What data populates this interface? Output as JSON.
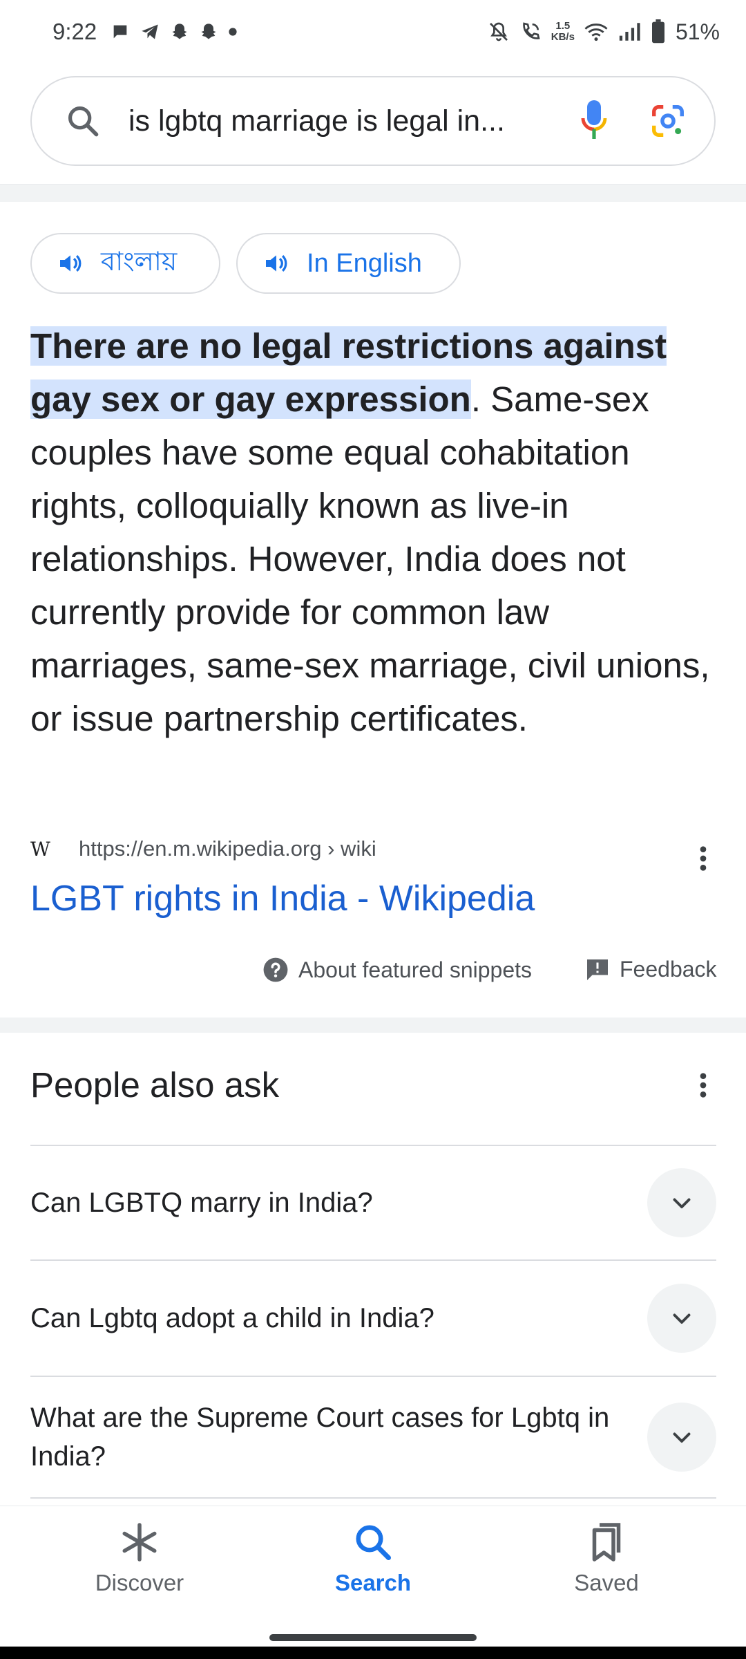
{
  "status_bar": {
    "time": "9:22",
    "net_speed_value": "1.5",
    "net_speed_unit": "KB/s",
    "battery": "51%",
    "icons": [
      "chat-icon",
      "telegram-icon",
      "snapchat-icon",
      "snapchat-icon",
      "dot-icon",
      "mute-icon",
      "wifi-calling-icon",
      "wifi-icon",
      "signal-icon",
      "battery-icon"
    ]
  },
  "search": {
    "query": "is lgbtq marriage is legal in..."
  },
  "chips": {
    "bengali": "বাংলায়",
    "english": "In English"
  },
  "snippet": {
    "highlight": "There are no legal restrictions against gay sex or gay expression",
    "rest": ". Same-sex couples have some equal cohabitation rights, colloquially known as live-in relationships. However, India does not currently provide for common law marriages, same-sex marriage, civil unions, or issue partnership certificates."
  },
  "source": {
    "logo": "W",
    "url": "https://en.m.wikipedia.org › wiki",
    "title": "LGBT rights in India - Wikipedia"
  },
  "meta": {
    "about": "About featured snippets",
    "feedback": "Feedback"
  },
  "paa": {
    "title": "People also ask",
    "questions": [
      "Can LGBTQ marry in India?",
      "Can Lgbtq adopt a child in India?",
      "What are the Supreme Court cases for Lgbtq in India?"
    ]
  },
  "nav": {
    "discover": "Discover",
    "search": "Search",
    "saved": "Saved",
    "active_color": "#1a73e8"
  }
}
